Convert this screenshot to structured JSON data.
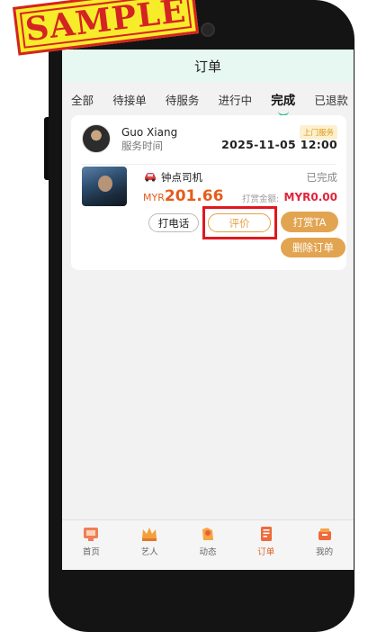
{
  "header": {
    "title": "订单"
  },
  "tabs": [
    {
      "label": "全部"
    },
    {
      "label": "待接单"
    },
    {
      "label": "待服务"
    },
    {
      "label": "进行中"
    },
    {
      "label": "完成"
    },
    {
      "label": "已退款"
    }
  ],
  "active_tab": "完成",
  "order": {
    "user_name": "Guo Xiang",
    "service_time_label": "服务时间",
    "service_type_badge": "上门服务",
    "service_time": "2025-11-05 12:00",
    "driver_name": "钟点司机",
    "status": "已完成",
    "price_currency": "MYR",
    "price_amount": "201.66",
    "tip_label": "打赏金额:",
    "tip_amount": "MYR0.00",
    "buttons": {
      "call": "打电话",
      "review": "评价",
      "tip": "打赏TA",
      "delete": "删除订单"
    }
  },
  "bottom_nav": [
    {
      "label": "首页",
      "icon": "home-icon"
    },
    {
      "label": "艺人",
      "icon": "crown-icon"
    },
    {
      "label": "动态",
      "icon": "feed-icon"
    },
    {
      "label": "订单",
      "icon": "order-icon"
    },
    {
      "label": "我的",
      "icon": "profile-icon"
    }
  ],
  "active_nav": "订单",
  "stamp": {
    "text": "SAMPLE"
  },
  "colors": {
    "accent": "#E2A451",
    "price": "#E45C1C",
    "tip_amount": "#E0243B",
    "highlight": "#E0181E",
    "header_bg": "#E7F7F1",
    "tab_underline": "#2BBF8A"
  }
}
